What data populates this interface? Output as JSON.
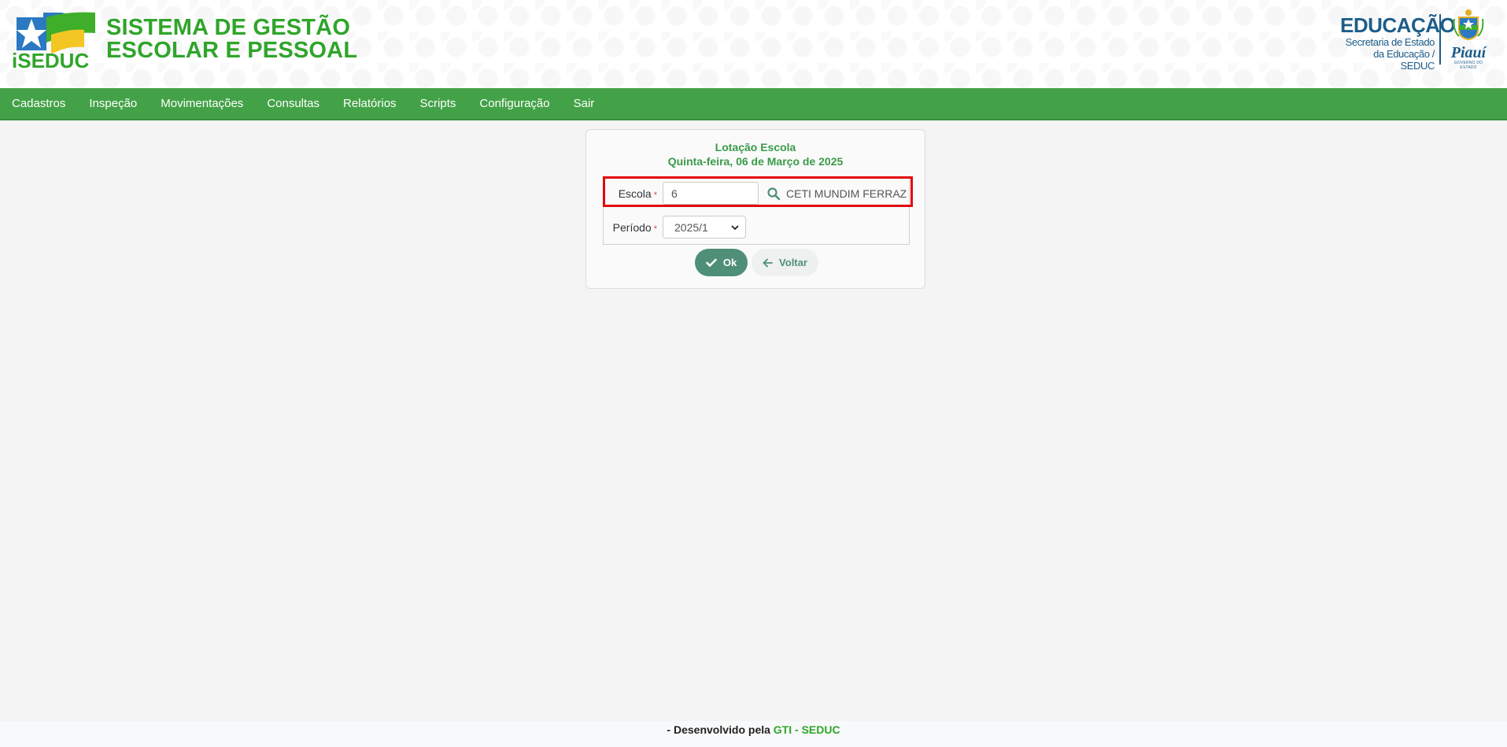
{
  "header": {
    "logo_text": "iSEDUC",
    "title_line1": "SISTEMA DE GESTÃO",
    "title_line2": "ESCOLAR E PESSOAL",
    "right_logo": {
      "title": "EDUCAÇÃO",
      "sub1": "Secretaria de Estado",
      "sub2": "da Educação / SEDUC",
      "state": "Piauí",
      "gov": "GOVERNO DO ESTADO"
    }
  },
  "nav": {
    "items": [
      {
        "label": "Cadastros"
      },
      {
        "label": "Inspeção"
      },
      {
        "label": "Movimentações"
      },
      {
        "label": "Consultas"
      },
      {
        "label": "Relatórios"
      },
      {
        "label": "Scripts"
      },
      {
        "label": "Configuração"
      },
      {
        "label": "Sair"
      }
    ]
  },
  "card": {
    "title": "Lotação Escola",
    "date": "Quinta-feira, 06 de Março de 2025",
    "escola": {
      "label": "Escola",
      "required": "*",
      "code_value": "6",
      "school_name": "CETI MUNDIM FERRAZ"
    },
    "periodo": {
      "label": "Período",
      "required": "*",
      "selected": "2025/1"
    },
    "buttons": {
      "ok": "Ok",
      "voltar": "Voltar"
    }
  },
  "footer": {
    "prefix": "- Desenvolvido pela ",
    "brand": "GTI - SEDUC"
  },
  "colors": {
    "brand_green": "#2fa52a",
    "nav_green": "#43a247",
    "button_teal": "#4f8f78",
    "highlight_red": "#e3080b",
    "edu_blue": "#1d5d8a"
  }
}
